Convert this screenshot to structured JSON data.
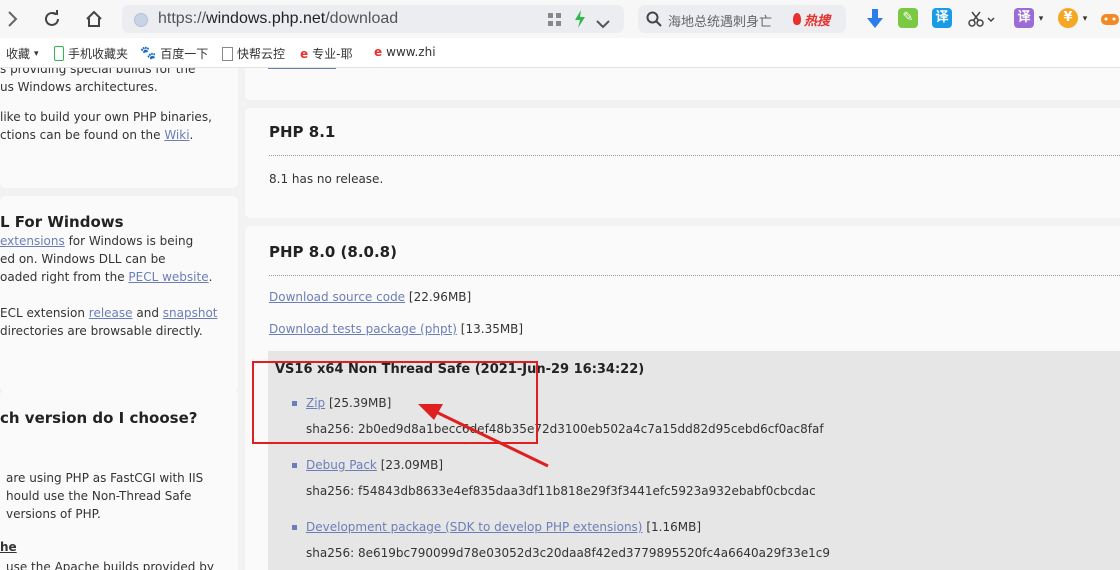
{
  "browser": {
    "url_scheme": "https://",
    "url_host": "windows.php.net",
    "url_path": "/download",
    "search_placeholder": "海地总统遇刺身亡",
    "search_hot_label": "热搜",
    "translate_label": "译",
    "translate_label2": "译",
    "accent": "#2b7de9"
  },
  "bookmarks": [
    {
      "label": "收藏"
    },
    {
      "label": "手机收藏夹"
    },
    {
      "label": "百度一下"
    },
    {
      "label": "快帮云控"
    },
    {
      "label": "专业-耶"
    },
    {
      "label": "www.zhi"
    }
  ],
  "sidebar": {
    "intro_line1": "s providing special builds for the",
    "intro_line2": "us Windows architectures.",
    "build_line1": " like to build your own PHP binaries,",
    "build_line2a": "ctions can be found on the ",
    "build_link": "Wiki",
    "build_line2b": ".",
    "pecl_heading": "L For Windows",
    "pecl_link1": "extensions",
    "pecl_line1b": " for Windows is being",
    "pecl_line2": "ed on. Windows DLL can be",
    "pecl_line3a": "oaded right from the ",
    "pecl_link2": "PECL website",
    "pecl_line3b": ".",
    "pecl_line4a": "ECL extension ",
    "pecl_link3": "release",
    "pecl_line4b": " and ",
    "pecl_link4": "snapshot",
    "pecl_line5": "directories are browsable directly.",
    "choose_heading": "ch version do I choose?",
    "iis_line1": "are using PHP as FastCGI with IIS",
    "iis_line2": "hould use the Non-Thread Safe",
    "iis_line3": "versions of PHP.",
    "apache_heading": "he",
    "apache_line1": "use the Apache builds provided by"
  },
  "main": {
    "php81": {
      "title": "PHP 8.1",
      "note": "8.1 has no release."
    },
    "php80": {
      "title": "PHP 8.0 (8.0.8)",
      "source_link": "Download source code",
      "source_size": "[22.96MB]",
      "tests_link": "Download tests package (phpt)",
      "tests_size": "[13.35MB]",
      "build_title": "VS16 x64 Non Thread Safe (2021-Jun-29 16:34:22)",
      "files": [
        {
          "name": "Zip",
          "size": "[25.39MB]",
          "sha": "sha256: 2b0ed9d8a1becc6def48b35e72d3100eb502a4c7a15dd82d95cebd6cf0ac8faf"
        },
        {
          "name": "Debug Pack",
          "size": "[23.09MB]",
          "sha": "sha256: f54843db8633e4ef835daa3df11b818e29f3f3441efc5923a932ebabf0cbcdac"
        },
        {
          "name": "Development package (SDK to develop PHP extensions)",
          "size": "[1.16MB]",
          "sha": "sha256: 8e619bc790099d78e03052d3c20daa8f42ed3779895520fc4a6640a29f33e1c9"
        }
      ]
    }
  },
  "annotation": {
    "box_color": "#e02020",
    "arrow_color": "#e02020"
  }
}
